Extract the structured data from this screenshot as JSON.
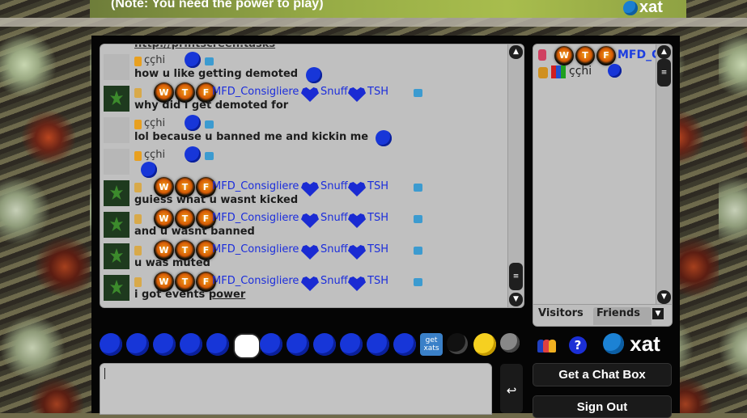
{
  "banner": {
    "note": "(Note: You need the power to play)",
    "brand": "xat"
  },
  "chat": {
    "top_cut_text": "http://printscreen.tasks",
    "messages": [
      {
        "user": "ççhi",
        "text": "how u like getting demoted",
        "type": "chi"
      },
      {
        "user": "MFD_Consigliere",
        "powers": [
          "W",
          "T",
          "F"
        ],
        "friends": [
          "Snuff",
          "TSH"
        ],
        "text": "why did i get demoted for",
        "type": "mfd"
      },
      {
        "user": "ççhi",
        "text": "lol because u banned me and kickin me",
        "type": "chi"
      },
      {
        "user": "ççhi",
        "text": "",
        "type": "chi"
      },
      {
        "user": "MFD_Consigliere",
        "powers": [
          "W",
          "T",
          "F"
        ],
        "friends": [
          "Snuff",
          "TSH"
        ],
        "text": "guiess what u wasnt kicked",
        "type": "mfd"
      },
      {
        "user": "MFD_Consigliere",
        "powers": [
          "W",
          "T",
          "F"
        ],
        "friends": [
          "Snuff",
          "TSH"
        ],
        "text": "and u wasnt banned",
        "type": "mfd"
      },
      {
        "user": "MFD_Consigliere",
        "powers": [
          "W",
          "T",
          "F"
        ],
        "friends": [
          "Snuff",
          "TSH"
        ],
        "text": "u was muted",
        "type": "mfd"
      },
      {
        "user": "MFD_Consigliere",
        "powers": [
          "W",
          "T",
          "F"
        ],
        "friends": [
          "Snuff",
          "TSH"
        ],
        "text_a": "i got events ",
        "text_b": "power",
        "type": "mfd"
      }
    ]
  },
  "sidebar": {
    "users": [
      {
        "name": "MFD_C",
        "color": "#1c3ee0"
      },
      {
        "name": "ççhi",
        "color": "#222222"
      }
    ],
    "tabs": {
      "visitors": "Visitors",
      "friends": "Friends"
    }
  },
  "smiley_bar": {
    "get_xats": "get xats"
  },
  "input": {
    "value": ""
  },
  "buttons": {
    "get_chat_box": "Get a Chat Box",
    "sign_out": "Sign Out",
    "help": "?",
    "send": "↩"
  },
  "logo": {
    "brand": "xat"
  }
}
